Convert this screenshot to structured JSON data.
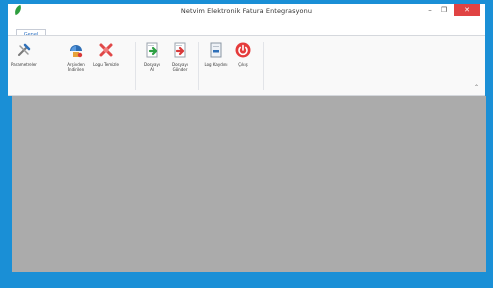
{
  "window": {
    "title": "Netvim Elektronik Fatura Entegrasyonu",
    "minimize_glyph": "–",
    "maximize_glyph": "❐",
    "close_glyph": "✕",
    "accent_color": "#1a8fd6",
    "close_color": "#e04343"
  },
  "ribbon": {
    "tab_label": "Genel",
    "buttons": [
      {
        "label": "Parametreler",
        "icon": "tools-icon"
      },
      {
        "label": "Arşivden\nİndirilen",
        "icon": "archive-download-icon"
      },
      {
        "label": "Logu Temizle",
        "icon": "clear-log-icon"
      },
      {
        "label": "Dosyayı\nAl",
        "icon": "file-import-icon"
      },
      {
        "label": "Dosyayı\nGönder",
        "icon": "file-send-icon"
      },
      {
        "label": "Log Kaydını",
        "icon": "log-record-icon"
      },
      {
        "label": "Çıkış",
        "icon": "power-icon"
      }
    ]
  }
}
